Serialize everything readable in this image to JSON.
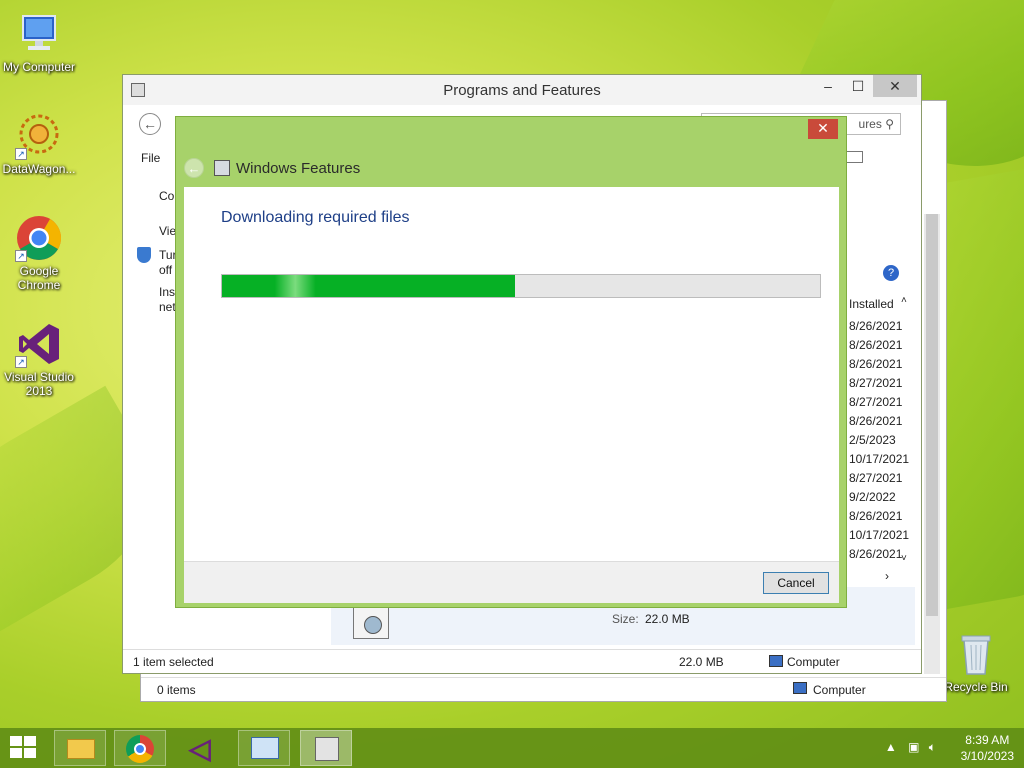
{
  "desktop": {
    "icons": [
      {
        "label": "My Computer"
      },
      {
        "label": "DataWagon..."
      },
      {
        "label": "Google Chrome"
      },
      {
        "label": "Visual Studio 2013"
      },
      {
        "label": "Recycle Bin"
      }
    ]
  },
  "programs_window": {
    "title": "Programs and Features",
    "search_placeholder": "ures",
    "menu_file": "File",
    "left_text": [
      "Co",
      "Vie",
      "Tur",
      "off",
      "Inst",
      "net"
    ],
    "installed_header": "Installed",
    "installed_dates": [
      "8/26/2021",
      "8/26/2021",
      "8/26/2021",
      "8/27/2021",
      "8/27/2021",
      "8/26/2021",
      "2/5/2023",
      "10/17/2021",
      "8/27/2021",
      "9/2/2022",
      "8/26/2021",
      "10/17/2021",
      "8/26/2021"
    ],
    "details_size_label": "Size:",
    "details_size_value": "22.0 MB",
    "status_selected": "1 item selected",
    "status_size": "22.0 MB",
    "status_location": "Computer"
  },
  "back_window": {
    "status_items": "0 items",
    "status_location": "Computer"
  },
  "windows_features": {
    "title": "Windows Features",
    "heading": "Downloading required files",
    "progress": 0.49,
    "cancel_label": "Cancel",
    "close_glyph": "✕"
  },
  "taskbar": {
    "time": "8:39 AM",
    "date": "3/10/2023"
  },
  "colors": {
    "progress_green": "#06b025",
    "dialog_frame": "#a7d26a",
    "heading_blue": "#1e3f87"
  }
}
